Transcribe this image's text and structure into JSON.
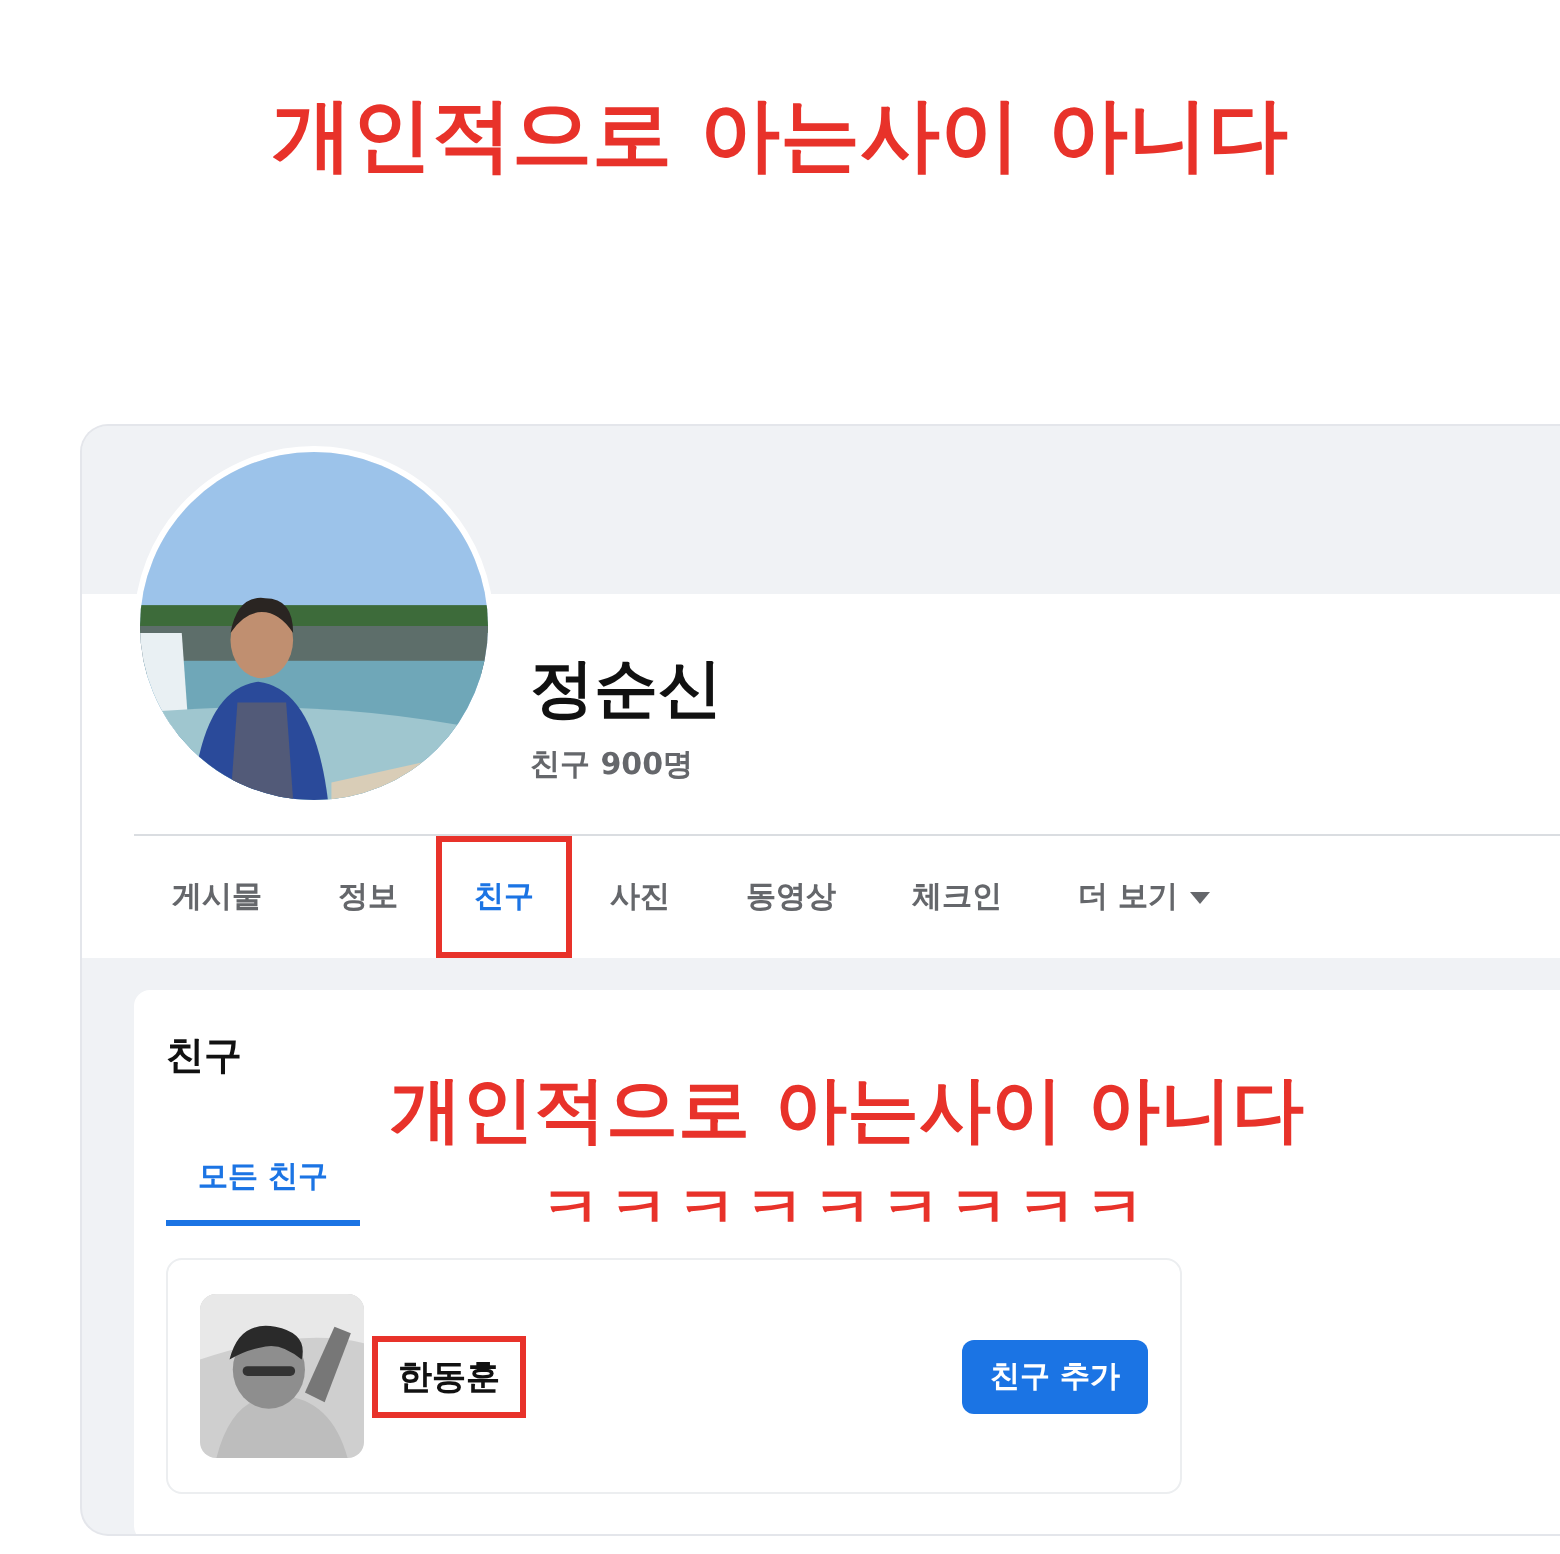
{
  "caption": "개인적으로 아는사이 아니다",
  "profile": {
    "name": "정순신",
    "friend_count": "친구 900명"
  },
  "tabs": [
    {
      "label": "게시물",
      "selected": false,
      "highlighted": false
    },
    {
      "label": "정보",
      "selected": false,
      "highlighted": false
    },
    {
      "label": "친구",
      "selected": true,
      "highlighted": true
    },
    {
      "label": "사진",
      "selected": false,
      "highlighted": false
    },
    {
      "label": "동영상",
      "selected": false,
      "highlighted": false
    },
    {
      "label": "체크인",
      "selected": false,
      "highlighted": false
    },
    {
      "label": "더 보기",
      "selected": false,
      "highlighted": false,
      "dropdown": true
    }
  ],
  "friends_section": {
    "title": "친구",
    "overlay_caption": [
      "개인적으로 아는사이 아니다",
      "ㅋㅋㅋㅋㅋㅋㅋㅋㅋ"
    ],
    "subtabs": [
      {
        "label": "모든 친구",
        "selected": true
      }
    ],
    "friends": [
      {
        "name": "한동훈",
        "highlighted": true,
        "button": "친구 추가"
      }
    ]
  }
}
